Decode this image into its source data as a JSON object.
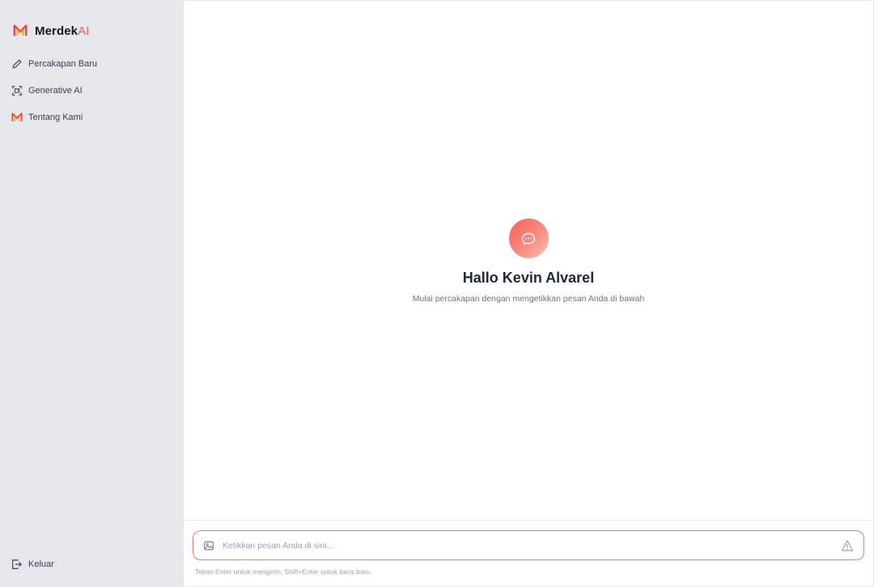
{
  "brand": {
    "name": "Merdek",
    "suffix": "AI",
    "accent": "#f0645a"
  },
  "sidebar": {
    "items": [
      {
        "label": "Percakapan Baru",
        "icon": "pencil-icon"
      },
      {
        "label": "Generative AI",
        "icon": "image-frame-icon"
      },
      {
        "label": "Tentang Kami",
        "icon": "merdekai-logo-icon"
      }
    ],
    "logout": {
      "label": "Keluar",
      "icon": "logout-icon"
    }
  },
  "welcome": {
    "icon": "chat-bubble-icon",
    "greeting": "Hallo Kevin Alvarel",
    "subtitle": "Mulai percakapan dengan mengetikkan pesan Anda di bawah"
  },
  "composer": {
    "placeholder": "Ketikkan pesan Anda di sini...",
    "value": "",
    "hint": "Tekan Enter untuk mengirim, Shift+Enter untuk baris baru",
    "attach_icon": "image-icon",
    "send_icon": "send-icon"
  }
}
